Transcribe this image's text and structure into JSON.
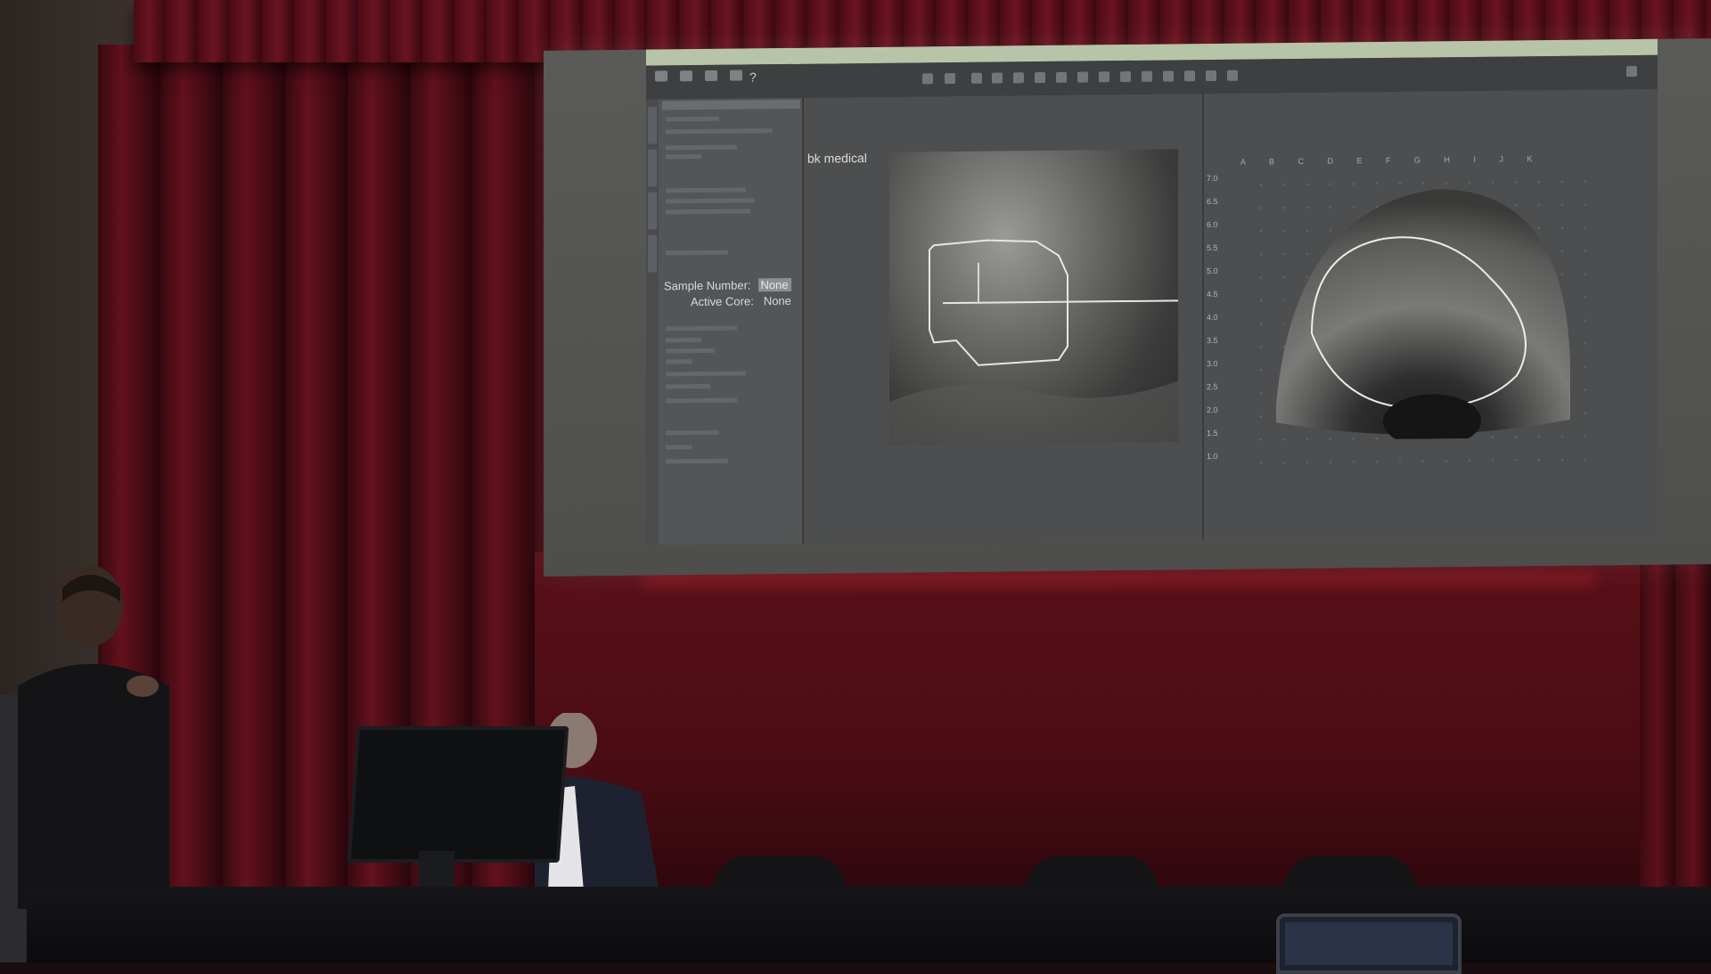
{
  "screen": {
    "logo_text": "bk medical",
    "sample_number_label": "Sample Number:",
    "sample_number_value": "None",
    "active_core_label": "Active Core:",
    "active_core_value": "None",
    "scale_ticks": [
      "7.0",
      "6.5",
      "6.0",
      "5.5",
      "5.0",
      "4.5",
      "4.0",
      "3.5",
      "3.0",
      "2.5",
      "2.0",
      "1.5",
      "1.0"
    ],
    "grid_letters": "A B C D E F G H I J K"
  },
  "colors": {
    "curtain": "#6e1420",
    "projection_bg": "#4e4e4c",
    "titlebar": "#b8c4a8",
    "ultrasound_contour": "#e8e8e6"
  }
}
